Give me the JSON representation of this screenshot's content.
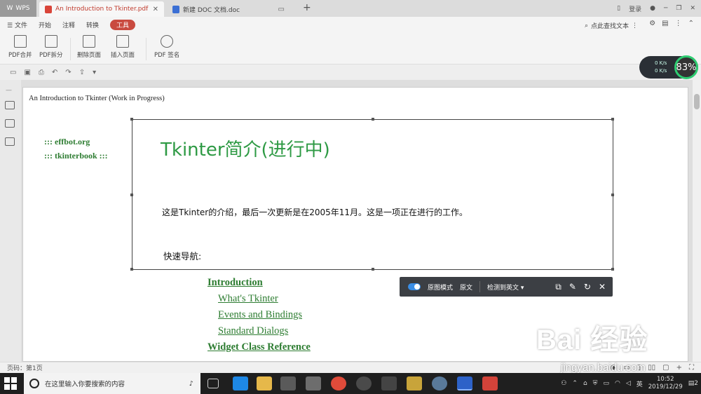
{
  "titlebar": {
    "app_label": "WPS",
    "tabs": [
      {
        "label": "An Introduction to Tkinter.pdf"
      },
      {
        "label": "新建 DOC 文档.doc"
      }
    ],
    "login_label": "登录"
  },
  "menubar": {
    "items": [
      "文件",
      "开始",
      "注释",
      "转换",
      "工具"
    ],
    "search_label": "点此查找文本"
  },
  "ribbon": {
    "buttons": [
      "PDF合并",
      "PDF拆分",
      "删除页面",
      "插入页面",
      "PDF 签名"
    ]
  },
  "speed_widget": {
    "upload": "0 K/s",
    "download": "0 K/s",
    "percent": "83%"
  },
  "document": {
    "header": "An Introduction to Tkinter (Work in Progress)",
    "side_links": [
      "::: effbot.org",
      "::: tkinterbook :::"
    ],
    "nav_links": [
      "Introduction",
      "What's Tkinter",
      "Events and Bindings",
      "Standard Dialogs",
      "Widget Class Reference"
    ]
  },
  "overlay": {
    "title": "Tkinter简介(进行中)",
    "paragraph": "这是Tkinter的介绍，最后一次更新是在2005年11月。这是一项正在进行的工作。",
    "nav_label": "快速导航:"
  },
  "translate_bar": {
    "mode_label": "原图模式",
    "original_label": "原文",
    "detect_label": "检测到英文"
  },
  "statusbar": {
    "page_info": "页码：第1页"
  },
  "taskbar": {
    "search_placeholder": "在这里输入你要搜索的内容",
    "time": "10:52",
    "date": "2019/12/29",
    "ime": "英",
    "notifications": "2"
  },
  "watermark": {
    "brand": "Bai 经验",
    "url": "jingyan.baidu.com"
  },
  "colors": {
    "accent_red": "#c94a3f",
    "link_green": "#2e7d32",
    "title_green": "#2e9a44"
  }
}
